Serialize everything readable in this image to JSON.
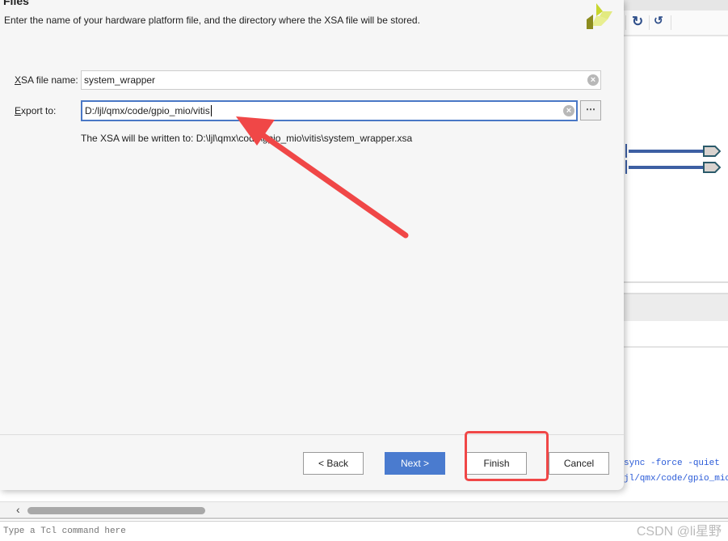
{
  "dialog": {
    "title": "Files",
    "description": "Enter the name of your hardware platform file, and the directory where the XSA file will be stored.",
    "xsa_label_key": "X",
    "xsa_label_rest": "SA file name:",
    "xsa_value": "system_wrapper",
    "export_label_key": "E",
    "export_label_rest": "xport to:",
    "export_value": "D:/ljl/qmx/code/gpio_mio/vitis",
    "browse_label": "⋯",
    "written_text": "The XSA will be written to: D:\\ljl\\qmx\\code\\gpio_mio\\vitis\\system_wrapper.xsa",
    "buttons": {
      "back": "< Back",
      "next": "Next >",
      "finish": "Finish",
      "cancel": "Cancel"
    }
  },
  "background": {
    "tcl_lines": [
      "sync -force -quiet",
      "jl/qmx/code/gpio_mio/"
    ],
    "tcl_placeholder": "Type a Tcl command here",
    "watermark": "CSDN @li星野"
  },
  "annotations": {
    "arrow_color": "#f04747",
    "highlight_color": "#f04747"
  }
}
